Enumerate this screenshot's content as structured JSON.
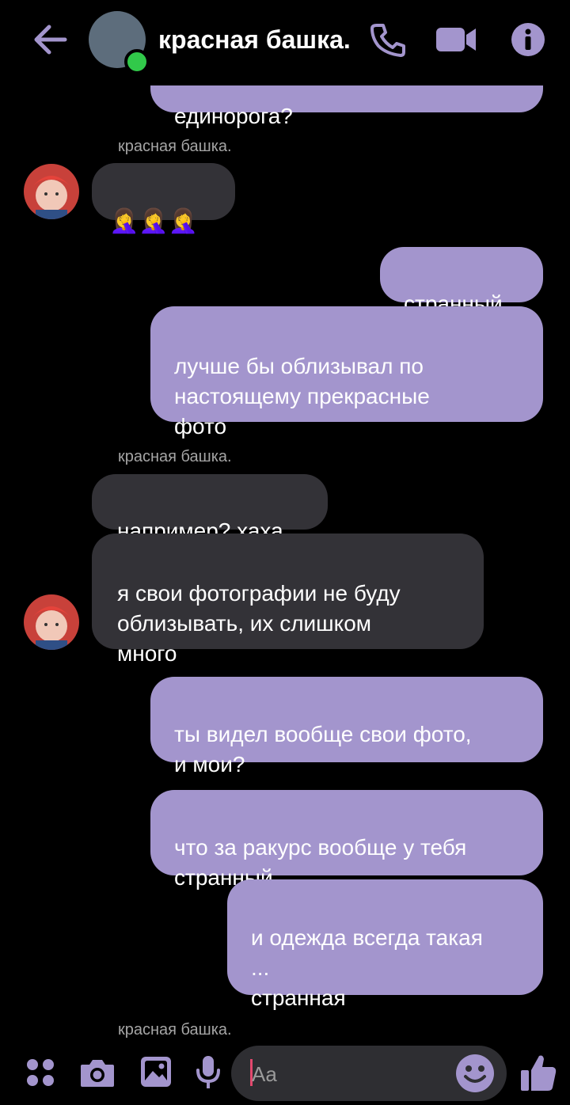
{
  "header": {
    "title": "красная башка.",
    "back_icon": "arrow-left-icon",
    "call_icon": "phone-icon",
    "video_icon": "video-camera-icon",
    "info_icon": "info-icon",
    "accent": "#a395cd",
    "online_color": "#31c94a"
  },
  "messages": {
    "partial_top": "единорога?",
    "sender_1": "красная башка.",
    "emoji_text": "🤦‍♀️🤦‍♀️🤦‍♀️",
    "out_1": "странный",
    "out_2": "лучше бы облизывал по\nнастоящему прекрасные\nфото",
    "sender_2": "красная башка.",
    "in_1": "например? хаха",
    "in_2": "я свои фотографии не буду\nоблизывать, их слишком\nмного",
    "out_3": "ты видел вообще свои фото,\nи мои?",
    "out_4": "что за ракурс вообще у тебя\nстранный",
    "out_5": "и одежда всегда такая\n...\nстранная",
    "sender_3": "красная башка."
  },
  "composer": {
    "placeholder": "Aa",
    "icons": [
      "apps-icon",
      "camera-icon",
      "image-icon",
      "microphone-icon",
      "emoji-icon",
      "thumbs-up-icon"
    ]
  }
}
